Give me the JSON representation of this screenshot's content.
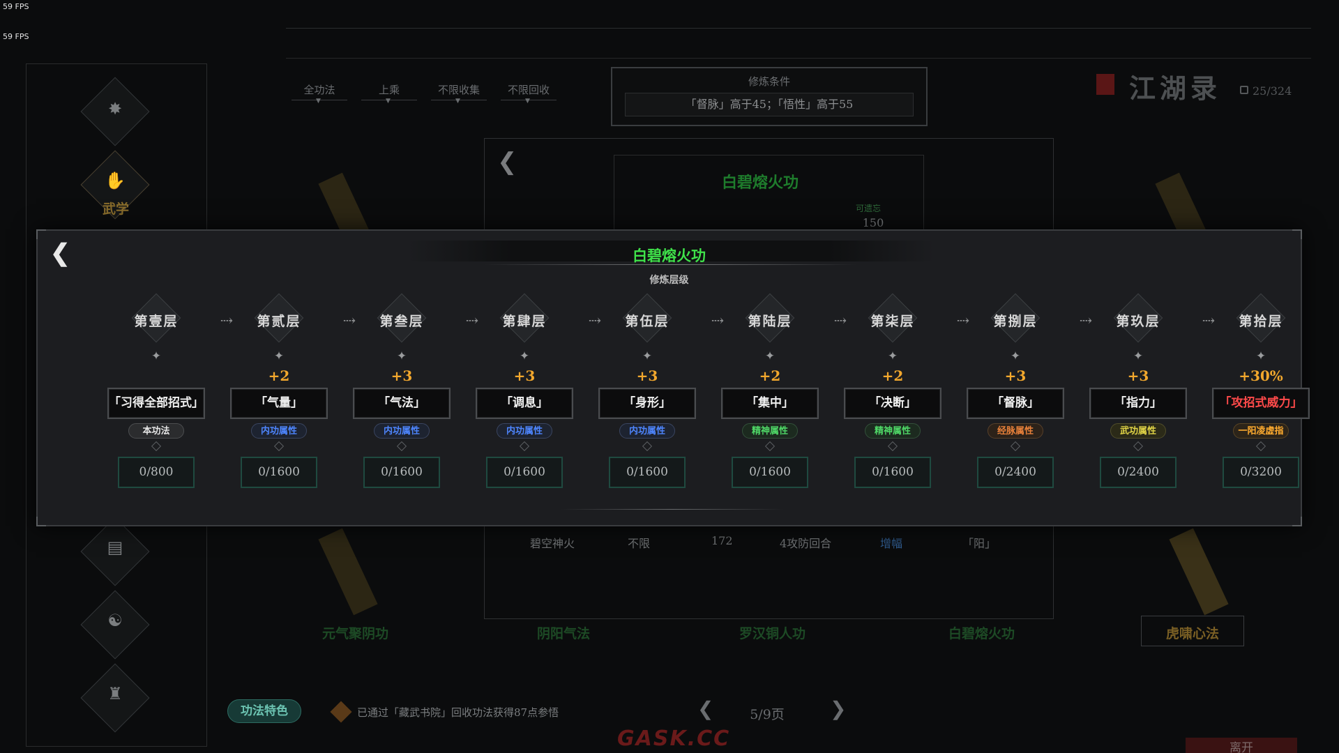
{
  "fps": [
    "59 FPS",
    "59 FPS"
  ],
  "filters": [
    "全功法",
    "上乘",
    "不限收集",
    "不限回收"
  ],
  "condition": {
    "title": "修炼条件",
    "text": "「督脉」高于45；「悟性」高于55"
  },
  "book": {
    "name": "江湖录",
    "count": "25/324"
  },
  "sidebar": {
    "active_label": "武学",
    "icons": [
      "bug-icon",
      "martial-icon",
      "scroll-icon",
      "orb-icon",
      "hand-icon",
      "robe-icon"
    ]
  },
  "mid": {
    "title": "白碧熔火功",
    "forget_label": "可遗忘",
    "forget_value": "150",
    "row": [
      "碧空神火",
      "不限",
      "172",
      "4攻防回合",
      "增幅",
      "「阳」"
    ]
  },
  "bg_books": [
    "元气聚阴功",
    "阴阳气法",
    "罗汉铜人功",
    "白碧熔火功"
  ],
  "bg_card": "虎啸心法",
  "feature_button": "功法特色",
  "notice": "已通过「藏武书院」回收功法获得87点参悟",
  "pager": "5/9页",
  "watermark": "GASK.CC",
  "leave": "离开",
  "modal": {
    "title": "白碧熔火功",
    "subtitle": "修炼层级",
    "layers": [
      {
        "name": "第壹层",
        "bonus": "",
        "stat": "「习得全部招式」",
        "tag": "本功法",
        "tag_style": "plain",
        "progress": "0/800"
      },
      {
        "name": "第贰层",
        "bonus": "+2",
        "stat": "「气量」",
        "tag": "内功属性",
        "tag_style": "blue",
        "progress": "0/1600"
      },
      {
        "name": "第叁层",
        "bonus": "+3",
        "stat": "「气法」",
        "tag": "内功属性",
        "tag_style": "blue",
        "progress": "0/1600"
      },
      {
        "name": "第肆层",
        "bonus": "+3",
        "stat": "「调息」",
        "tag": "内功属性",
        "tag_style": "blue",
        "progress": "0/1600"
      },
      {
        "name": "第伍层",
        "bonus": "+3",
        "stat": "「身形」",
        "tag": "内功属性",
        "tag_style": "blue",
        "progress": "0/1600"
      },
      {
        "name": "第陆层",
        "bonus": "+2",
        "stat": "「集中」",
        "tag": "精神属性",
        "tag_style": "green",
        "progress": "0/1600"
      },
      {
        "name": "第柒层",
        "bonus": "+2",
        "stat": "「决断」",
        "tag": "精神属性",
        "tag_style": "green",
        "progress": "0/1600"
      },
      {
        "name": "第捌层",
        "bonus": "+3",
        "stat": "「督脉」",
        "tag": "经脉属性",
        "tag_style": "orange",
        "progress": "0/2400"
      },
      {
        "name": "第玖层",
        "bonus": "+3",
        "stat": "「指力」",
        "tag": "武功属性",
        "tag_style": "yellow",
        "progress": "0/2400"
      },
      {
        "name": "第拾层",
        "bonus": "+30%",
        "stat": "「攻招式威力」",
        "tag": "一阳凌虚指",
        "tag_style": "gold",
        "progress": "0/3200",
        "stat_color": "red"
      }
    ]
  }
}
